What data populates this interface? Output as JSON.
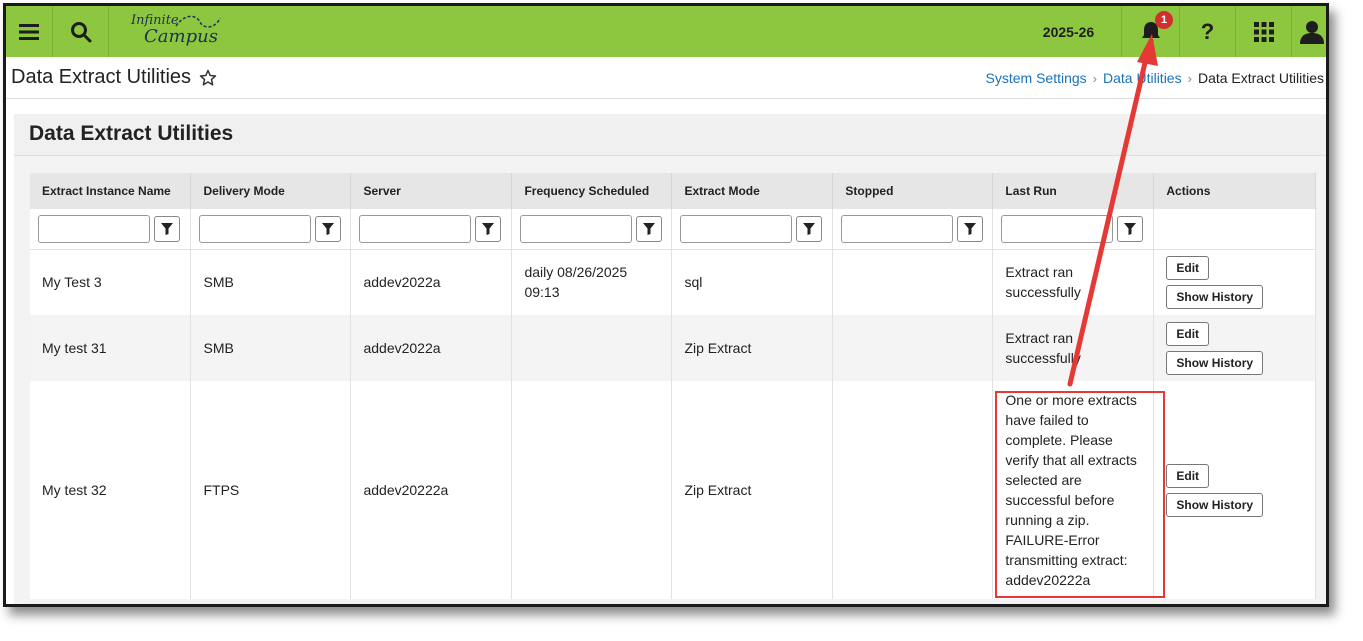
{
  "topbar": {
    "logo_line1": "Infinite",
    "logo_line2": "Campus",
    "year": "2025-26",
    "notification_count": "1",
    "help": "?"
  },
  "page": {
    "title": "Data Extract Utilities",
    "breadcrumbs": [
      "System Settings",
      "Data Utilities",
      "Data Extract Utilities"
    ]
  },
  "section": {
    "title": "Data Extract Utilities"
  },
  "table": {
    "headers": [
      "Extract Instance Name",
      "Delivery Mode",
      "Server",
      "Frequency Scheduled",
      "Extract Mode",
      "Stopped",
      "Last Run",
      "Actions"
    ],
    "rows": [
      {
        "name": "My Test 3",
        "delivery": "SMB",
        "server": "addev2022a",
        "frequency": "daily 08/26/2025 09:13",
        "mode": "sql",
        "stopped": "",
        "last_run": "Extract ran successfully"
      },
      {
        "name": "My test 31",
        "delivery": "SMB",
        "server": "addev2022a",
        "frequency": "",
        "mode": "Zip Extract",
        "stopped": "",
        "last_run": "Extract ran successfully"
      },
      {
        "name": "My test 32",
        "delivery": "FTPS",
        "server": "addev20222a",
        "frequency": "",
        "mode": "Zip Extract",
        "stopped": "",
        "last_run": "One or more extracts have failed to complete. Please verify that all extracts selected are successful before running a zip. FAILURE-Error transmitting extract: addev20222a"
      }
    ],
    "edit_label": "Edit",
    "history_label": "Show History"
  },
  "colors": {
    "topbar": "#8dc63f",
    "link": "#1a73b8",
    "callout": "#e53935",
    "badge": "#d32f2f"
  },
  "icons": [
    "menu-icon",
    "search-icon",
    "bell-icon",
    "help-icon",
    "apps-grid-icon",
    "user-icon",
    "star-icon",
    "filter-icon"
  ]
}
